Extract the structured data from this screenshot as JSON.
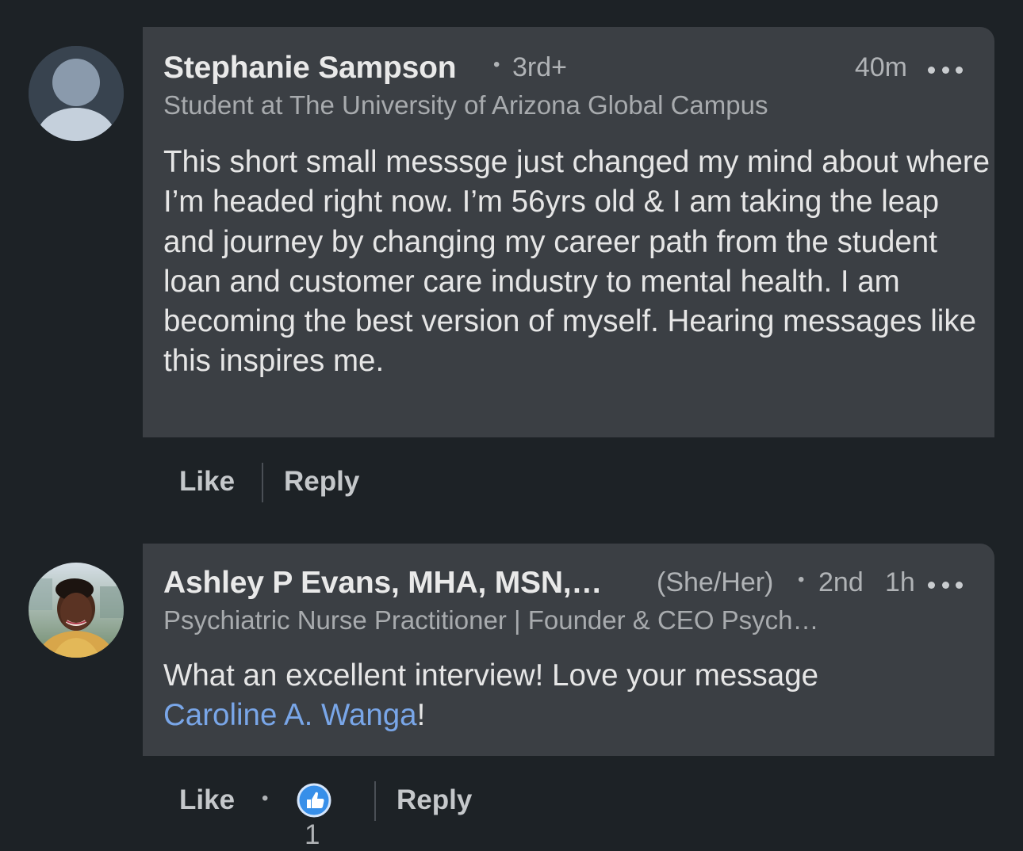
{
  "comments": [
    {
      "author": "Stephanie Sampson",
      "degree_sep": "•",
      "degree": "3rd+",
      "time": "40m",
      "headline": "Student at The University of Arizona Global Campus",
      "body": "This short small messsge just changed my mind about where I’m headed right now. I’m 56yrs old & I am taking the leap and journey by changing my career path from the student loan and customer care industry to mental health. I am becoming the best version of myself. Hearing messages like this inspires me.",
      "avatar_icon": "default-person-icon",
      "actions": {
        "like": "Like",
        "reply": "Reply"
      }
    },
    {
      "author": "Ashley P Evans, MHA, MSN,…",
      "pronouns": "(She/Her)",
      "degree_sep": "•",
      "degree": "2nd",
      "time": "1h",
      "headline": "Psychiatric Nurse Practitioner | Founder & CEO Psych…",
      "body_prefix": "What an excellent interview! Love your message",
      "mention": "Caroline A. Wanga",
      "body_suffix": "!",
      "avatar_icon": "profile-photo",
      "actions": {
        "like": "Like",
        "sep": "•",
        "reaction_icon": "thumbs-up-icon",
        "reaction_count": "1",
        "reply": "Reply"
      }
    }
  ],
  "colors": {
    "background": "#1d2226",
    "bubble": "#3b3f44",
    "mention": "#79a6e8",
    "like_badge": "#378fe9"
  }
}
